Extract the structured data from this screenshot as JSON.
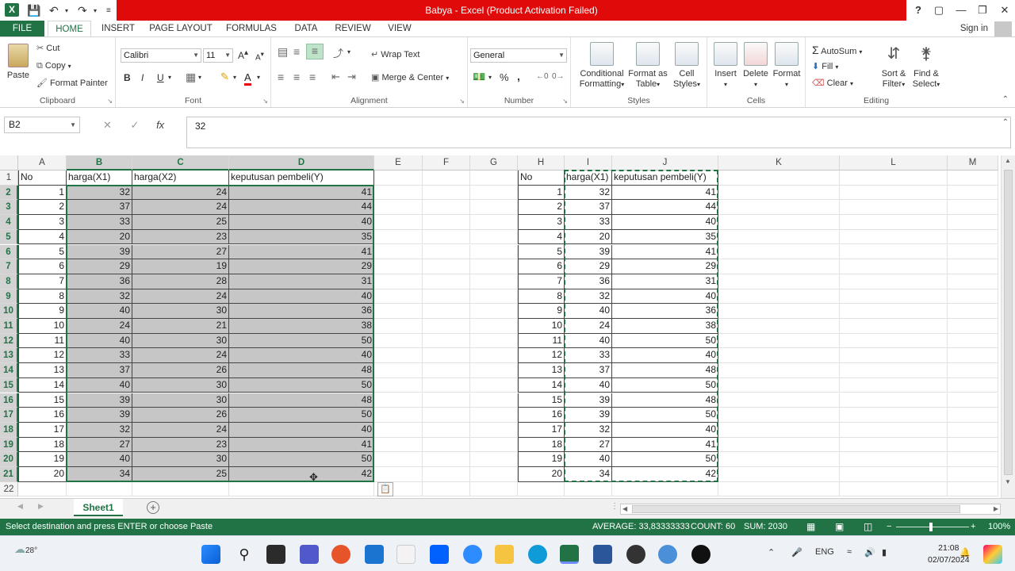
{
  "window": {
    "title": "Babya  -  Excel (Product Activation Failed)",
    "help": "?",
    "controls": [
      "▢",
      "—",
      "❐",
      "✕"
    ]
  },
  "ribbon_tabs": [
    "FILE",
    "HOME",
    "INSERT",
    "PAGE LAYOUT",
    "FORMULAS",
    "DATA",
    "REVIEW",
    "VIEW"
  ],
  "signin": "Sign in",
  "clipboard": {
    "paste": "Paste",
    "cut": "Cut",
    "copy": "Copy",
    "format_painter": "Format Painter",
    "label": "Clipboard"
  },
  "font": {
    "name": "Calibri",
    "size": "11",
    "bold": "B",
    "italic": "I",
    "underline": "U",
    "grow": "A",
    "shrink": "A",
    "color_letter": "A",
    "label": "Font"
  },
  "alignment": {
    "wrap_text": "Wrap Text",
    "merge_center": "Merge & Center",
    "label": "Alignment"
  },
  "number": {
    "format": "General",
    "percent": "%",
    "comma": ",",
    "label": "Number"
  },
  "styles": {
    "conditional_formatting_1": "Conditional",
    "conditional_formatting_2": "Formatting",
    "format_as_table_1": "Format as",
    "format_as_table_2": "Table",
    "cell_styles_1": "Cell",
    "cell_styles_2": "Styles",
    "label": "Styles"
  },
  "cells": {
    "insert": "Insert",
    "delete": "Delete",
    "format": "Format",
    "label": "Cells"
  },
  "editing": {
    "autosum": "AutoSum",
    "fill": "Fill",
    "clear": "Clear",
    "sort_filter_1": "Sort &",
    "sort_filter_2": "Filter",
    "find_select_1": "Find &",
    "find_select_2": "Select",
    "label": "Editing"
  },
  "formula_bar": {
    "name_box": "B2",
    "cancel": "✕",
    "enter": "✓",
    "fx": "fx",
    "value": "32"
  },
  "columns": [
    "A",
    "B",
    "C",
    "D",
    "E",
    "F",
    "G",
    "H",
    "I",
    "J",
    "K",
    "L",
    "M"
  ],
  "rows": [
    "1",
    "2",
    "3",
    "4",
    "5",
    "6",
    "7",
    "8",
    "9",
    "10",
    "11",
    "12",
    "13",
    "14",
    "15",
    "16",
    "17",
    "18",
    "19",
    "20",
    "21",
    "22"
  ],
  "table_left": {
    "headers": [
      "No",
      "harga(X1)",
      "harga(X2)",
      "keputusan pembeli(Y)"
    ],
    "rows": [
      [
        "1",
        "32",
        "24",
        "41"
      ],
      [
        "2",
        "37",
        "24",
        "44"
      ],
      [
        "3",
        "33",
        "25",
        "40"
      ],
      [
        "4",
        "20",
        "23",
        "35"
      ],
      [
        "5",
        "39",
        "27",
        "41"
      ],
      [
        "6",
        "29",
        "19",
        "29"
      ],
      [
        "7",
        "36",
        "28",
        "31"
      ],
      [
        "8",
        "32",
        "24",
        "40"
      ],
      [
        "9",
        "40",
        "30",
        "36"
      ],
      [
        "10",
        "24",
        "21",
        "38"
      ],
      [
        "11",
        "40",
        "30",
        "50"
      ],
      [
        "12",
        "33",
        "24",
        "40"
      ],
      [
        "13",
        "37",
        "26",
        "48"
      ],
      [
        "14",
        "40",
        "30",
        "50"
      ],
      [
        "15",
        "39",
        "30",
        "48"
      ],
      [
        "16",
        "39",
        "26",
        "50"
      ],
      [
        "17",
        "32",
        "24",
        "40"
      ],
      [
        "18",
        "27",
        "23",
        "41"
      ],
      [
        "19",
        "40",
        "30",
        "50"
      ],
      [
        "20",
        "34",
        "25",
        "42"
      ]
    ]
  },
  "table_right": {
    "headers": [
      "No",
      "harga(X1)",
      "keputusan pembeli(Y)"
    ],
    "rows": [
      [
        "1",
        "32",
        "41"
      ],
      [
        "2",
        "37",
        "44"
      ],
      [
        "3",
        "33",
        "40"
      ],
      [
        "4",
        "20",
        "35"
      ],
      [
        "5",
        "39",
        "41"
      ],
      [
        "6",
        "29",
        "29"
      ],
      [
        "7",
        "36",
        "31"
      ],
      [
        "8",
        "32",
        "40"
      ],
      [
        "9",
        "40",
        "36"
      ],
      [
        "10",
        "24",
        "38"
      ],
      [
        "11",
        "40",
        "50"
      ],
      [
        "12",
        "33",
        "40"
      ],
      [
        "13",
        "37",
        "48"
      ],
      [
        "14",
        "40",
        "50"
      ],
      [
        "15",
        "39",
        "48"
      ],
      [
        "16",
        "39",
        "50"
      ],
      [
        "17",
        "32",
        "40"
      ],
      [
        "18",
        "27",
        "41"
      ],
      [
        "19",
        "40",
        "50"
      ],
      [
        "20",
        "34",
        "42"
      ]
    ]
  },
  "sheet_tab": "Sheet1",
  "status_bar": {
    "message": "Select destination and press ENTER or choose Paste",
    "average": "AVERAGE: 33,83333333",
    "count": "COUNT: 60",
    "sum": "SUM: 2030",
    "zoom": "100%"
  },
  "taskbar": {
    "weather": "28°",
    "lang": "ENG",
    "time": "21:08",
    "date": "02/07/2024"
  },
  "colors": {
    "excel_green": "#217346",
    "title_red": "#e00a0a",
    "selection_shade": "#c6c6c6"
  }
}
